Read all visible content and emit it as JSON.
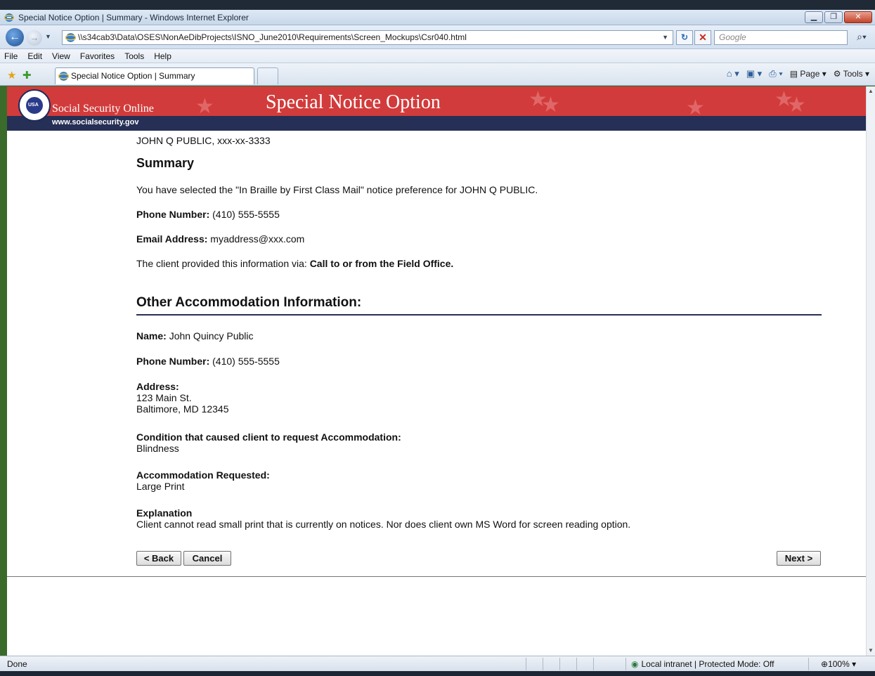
{
  "window": {
    "title": "Special Notice Option | Summary - Windows Internet Explorer",
    "controls": [
      "minimize",
      "maximize",
      "close"
    ]
  },
  "addressbar": {
    "url": "\\\\s34cab3\\Data\\OSES\\NonAeDibProjects\\ISNO_June2010\\Requirements\\Screen_Mockups\\Csr040.html",
    "search_placeholder": "Google"
  },
  "menu": [
    "File",
    "Edit",
    "View",
    "Favorites",
    "Tools",
    "Help"
  ],
  "tabs": [
    {
      "label": "Special Notice Option | Summary",
      "active": true
    }
  ],
  "commandbar": {
    "page_label": "Page",
    "tools_label": "Tools"
  },
  "banner": {
    "brand": "Social Security Online",
    "title": "Special Notice Option",
    "site_url": "www.socialsecurity.gov",
    "seal_text": "USA",
    "colors": {
      "red": "#d23b3b",
      "navy": "#262f55"
    }
  },
  "summary": {
    "client_line": "JOHN Q PUBLIC, xxx-xx-3333",
    "heading": "Summary",
    "selection_text": "You have selected the \"In Braille by First Class Mail\" notice preference for JOHN Q PUBLIC.",
    "phone_label": "Phone Number:",
    "phone_value": "(410) 555-5555",
    "email_label": "Email Address:",
    "email_value": "myaddress@xxx.com",
    "via_text": "The client provided this information via:",
    "via_value": "Call to or from the Field Office."
  },
  "accommodation": {
    "heading": "Other Accommodation Information:",
    "name_label": "Name:",
    "name_value": "John Quincy Public",
    "phone_label": "Phone Number:",
    "phone_value": "(410) 555-5555",
    "address_label": "Address:",
    "address_line1": "123 Main St.",
    "address_line2": "Baltimore, MD 12345",
    "condition_label": "Condition that caused client to request Accommodation:",
    "condition_value": "Blindness",
    "requested_label": "Accommodation Requested:",
    "requested_value": "Large Print",
    "explanation_label": "Explanation",
    "explanation_value": "Client cannot read small print that is currently on notices. Nor does client own MS Word for screen reading option."
  },
  "buttons": {
    "back": "< Back",
    "cancel": "Cancel",
    "next": "Next >"
  },
  "statusbar": {
    "status": "Done",
    "zone": "Local intranet | Protected Mode: Off",
    "zoom": "100%"
  }
}
